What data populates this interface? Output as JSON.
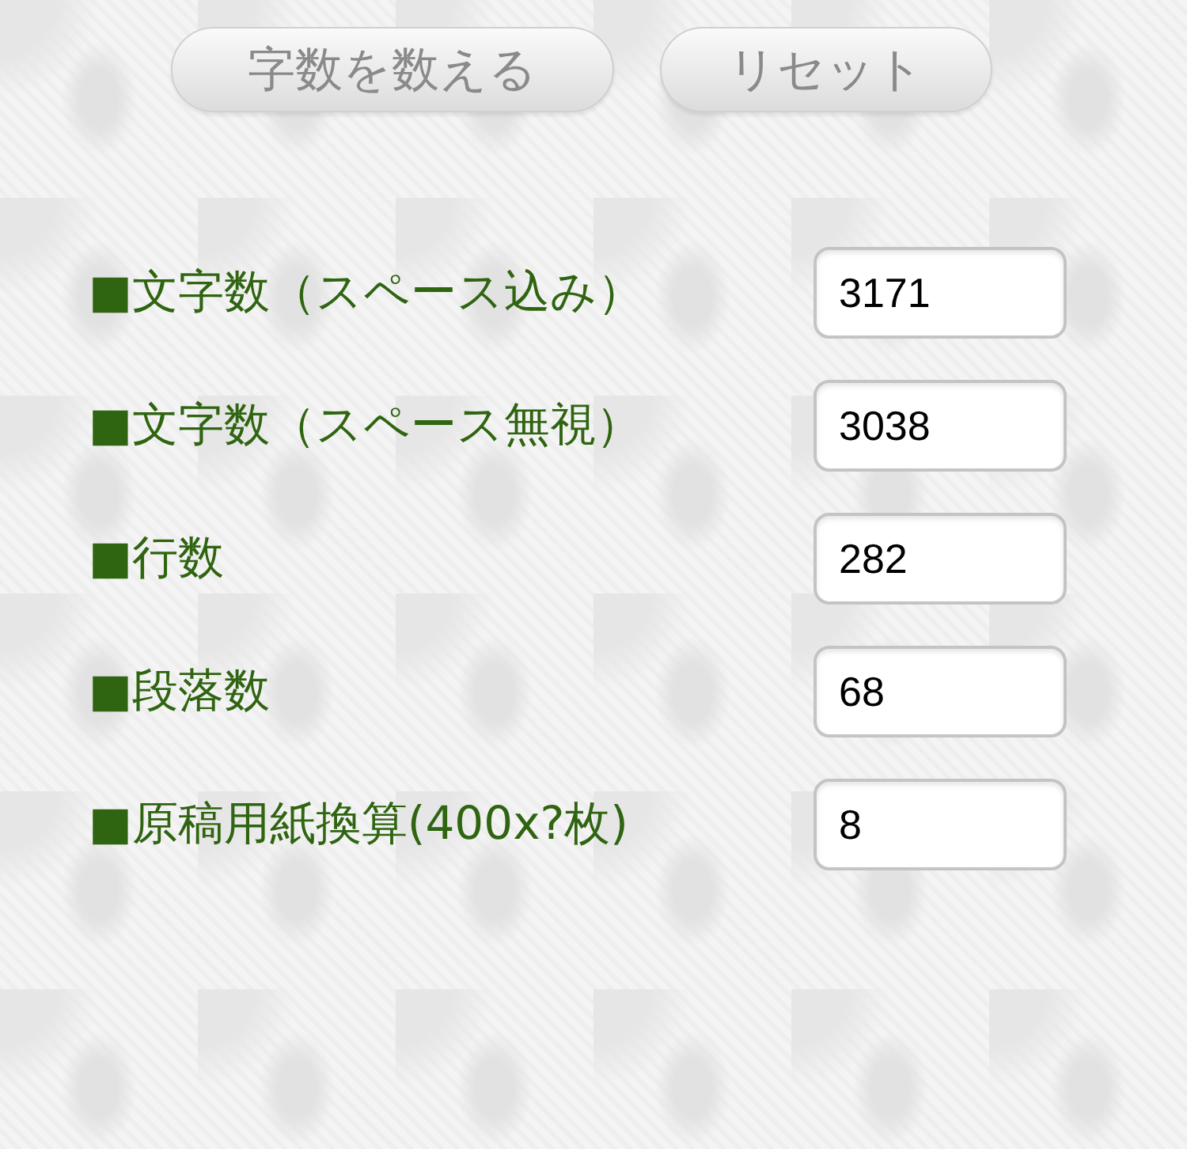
{
  "buttons": [
    {
      "label": "字数を数える"
    },
    {
      "label": "リセット"
    }
  ],
  "results": [
    {
      "label": "■文字数（スペース込み）",
      "value": "3171"
    },
    {
      "label": "■文字数（スペース無視）",
      "value": "3038"
    },
    {
      "label": "■行数",
      "value": "282"
    },
    {
      "label": "■段落数",
      "value": "68"
    },
    {
      "label": "■原稿用紙換算(400x?枚)",
      "value": "8"
    }
  ]
}
